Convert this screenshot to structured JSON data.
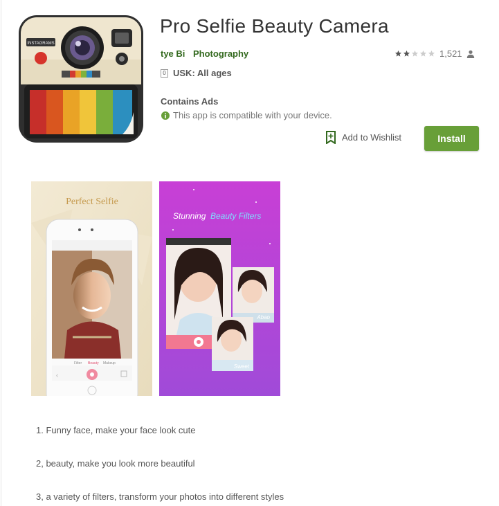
{
  "app": {
    "title": "Pro Selfie Beauty Camera",
    "developer": "tye Bi",
    "category": "Photography",
    "rating_count": "1,521",
    "rating_stars": 2,
    "rating_max": 5,
    "content_rating_badge": "0",
    "content_rating": "USK: All ages",
    "contains_ads": "Contains Ads",
    "compatibility": "This app is compatible with your device."
  },
  "actions": {
    "wishlist_label": "Add to Wishlist",
    "install_label": "Install"
  },
  "icon_camera_label": "INSTAGRAMS",
  "screenshots": {
    "shot1": {
      "title": "Perfect Selfie",
      "tabs": [
        "Filter",
        "Beauty",
        "Makeup"
      ]
    },
    "shot2": {
      "title_part1": "Stunning",
      "title_part2": "Beauty Filters",
      "label_abao": "Abao",
      "label_sweet": "Sweet"
    }
  },
  "description": [
    "1. Funny face, make your face look cute",
    "2, beauty, make you look more beautiful",
    "3, a variety of filters, transform your photos into different styles"
  ],
  "colors": {
    "install": "#689f38",
    "developer_link": "#33691e",
    "star_filled": "#555555",
    "star_empty": "#cccccc",
    "compat_icon": "#689f38"
  },
  "icons": [
    "star-icon",
    "person-icon",
    "info-icon",
    "bookmark-add-icon",
    "camera-icon"
  ]
}
